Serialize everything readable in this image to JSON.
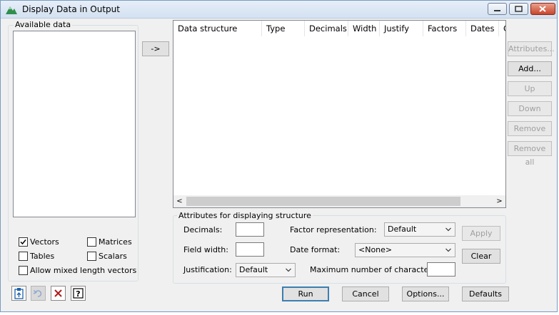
{
  "window": {
    "title": "Display Data in Output"
  },
  "available_data": {
    "label": "Available data"
  },
  "transfer_button": "->",
  "table": {
    "columns": [
      "Data structure",
      "Type",
      "Decimals",
      "Width",
      "Justify",
      "Factors",
      "Dates",
      "C"
    ]
  },
  "side_buttons": {
    "attributes": "Attributes...",
    "add": "Add...",
    "up": "Up",
    "down": "Down",
    "remove": "Remove",
    "remove_all": "Remove all"
  },
  "filters": {
    "vectors": {
      "label": "Vectors",
      "checked": true
    },
    "matrices": {
      "label": "Matrices",
      "checked": false
    },
    "tables": {
      "label": "Tables",
      "checked": false
    },
    "scalars": {
      "label": "Scalars",
      "checked": false
    },
    "mixed": {
      "label": "Allow mixed length vectors",
      "checked": false
    }
  },
  "attributes_group": {
    "label": "Attributes for displaying structure",
    "decimals_label": "Decimals:",
    "decimals_value": "",
    "field_width_label": "Field width:",
    "field_width_value": "",
    "justification_label": "Justification:",
    "justification_value": "Default",
    "factor_rep_label": "Factor representation:",
    "factor_rep_value": "Default",
    "date_format_label": "Date format:",
    "date_format_value": "<None>",
    "max_chars_label": "Maximum number of characters:",
    "max_chars_value": "",
    "apply": "Apply",
    "clear": "Clear"
  },
  "footer": {
    "run": "Run",
    "cancel": "Cancel",
    "options": "Options...",
    "defaults": "Defaults"
  },
  "colors": {
    "title_bar": "#dce7f4",
    "close_button": "#c8462c",
    "default_button_border": "#3c7fb1"
  }
}
